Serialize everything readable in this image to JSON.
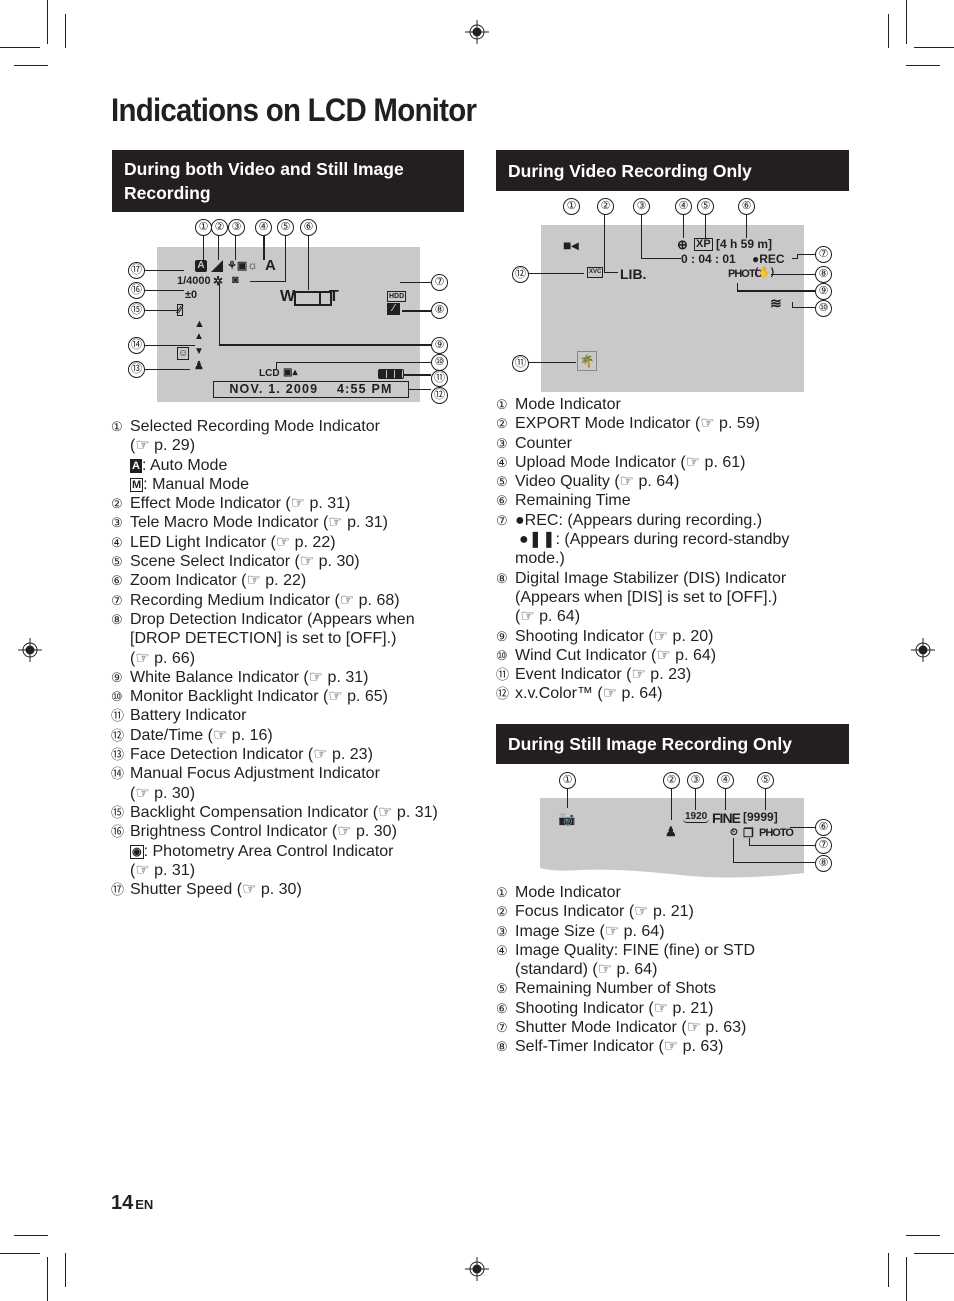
{
  "page": {
    "title": "Indications on LCD Monitor",
    "page_number": "14",
    "language": "EN",
    "ref_icon": "☞"
  },
  "sections": {
    "both": {
      "header": "During both Video and Still Image Recording",
      "lcd": {
        "shutter": "1/4000",
        "brightness": "±0",
        "zoom_w": "W",
        "zoom_t": "T",
        "medium": "HDD",
        "lcd_label": "LCD",
        "datetime": "NOV. 1. 2009    4:55 PM",
        "scene": "A"
      },
      "callouts": [
        "①",
        "②",
        "③",
        "④",
        "⑤",
        "⑥",
        "⑦",
        "⑧",
        "⑨",
        "⑩",
        "⑪",
        "⑫",
        "⑬",
        "⑭",
        "⑮",
        "⑯",
        "⑰"
      ],
      "items": [
        {
          "num": "①",
          "text": "Selected Recording Mode Indicator",
          "cont": "(☞ p. 29)"
        },
        {
          "num": "",
          "badge": "A",
          "badge_fill": true,
          "text": ": Auto Mode"
        },
        {
          "num": "",
          "badge": "M",
          "badge_fill": false,
          "text": ": Manual Mode"
        },
        {
          "num": "②",
          "text": "Effect Mode Indicator (☞ p. 31)"
        },
        {
          "num": "③",
          "text": "Tele Macro Mode Indicator (☞ p. 31)"
        },
        {
          "num": "④",
          "text": "LED Light Indicator (☞ p. 22)"
        },
        {
          "num": "⑤",
          "text": "Scene Select Indicator (☞ p. 30)"
        },
        {
          "num": "⑥",
          "text": "Zoom Indicator (☞ p. 22)"
        },
        {
          "num": "⑦",
          "text": "Recording Medium Indicator (☞ p. 68)"
        },
        {
          "num": "⑧",
          "text": "Drop Detection Indicator (Appears when",
          "cont": "[DROP DETECTION] is set to [OFF].)",
          "cont2": "(☞ p. 66)"
        },
        {
          "num": "⑨",
          "text": "White Balance Indicator (☞ p. 31)"
        },
        {
          "num": "⑩",
          "text": "Monitor Backlight Indicator (☞ p. 65)"
        },
        {
          "num": "⑪",
          "text": "Battery Indicator"
        },
        {
          "num": "⑫",
          "text": "Date/Time (☞ p. 16)"
        },
        {
          "num": "⑬",
          "text": "Face Detection Indicator (☞ p. 23)"
        },
        {
          "num": "⑭",
          "text": "Manual Focus Adjustment Indicator",
          "cont": "(☞ p. 30)"
        },
        {
          "num": "⑮",
          "text": "Backlight Compensation Indicator (☞ p. 31)"
        },
        {
          "num": "⑯",
          "text": "Brightness Control Indicator (☞ p. 30)"
        },
        {
          "num": "",
          "badge": "◉",
          "badge_fill": false,
          "text": ": Photometry Area Control Indicator",
          "cont": "(☞ p. 31)"
        },
        {
          "num": "⑰",
          "text": "Shutter Speed (☞ p. 30)"
        }
      ]
    },
    "video": {
      "header": "During Video Recording Only",
      "lcd": {
        "export": "LIB.",
        "xvc": "XVC",
        "quality": "XP",
        "remaining": "[4 h 59 m]",
        "counter": "0 : 04 : 01",
        "rec": "●REC",
        "photo": "PHOTO"
      },
      "callouts": [
        "①",
        "②",
        "③",
        "④",
        "⑤",
        "⑥",
        "⑦",
        "⑧",
        "⑨",
        "⑩",
        "⑪",
        "⑫"
      ],
      "items": [
        {
          "num": "①",
          "text": "Mode Indicator"
        },
        {
          "num": "②",
          "text": "EXPORT Mode Indicator (☞ p. 59)"
        },
        {
          "num": "③",
          "text": "Counter"
        },
        {
          "num": "④",
          "text": "Upload Mode Indicator (☞ p. 61)"
        },
        {
          "num": "⑤",
          "text": "Video Quality (☞ p. 64)"
        },
        {
          "num": "⑥",
          "text": "Remaining Time"
        },
        {
          "num": "⑦",
          "text": " ●REC: (Appears during recording.)",
          "cont": "●❚❚: (Appears during record-standby",
          "cont2": "mode.)"
        },
        {
          "num": "⑧",
          "text": "Digital Image Stabilizer (DIS) Indicator",
          "cont": "(Appears when [DIS] is set to [OFF].)",
          "cont2": "(☞ p. 64)"
        },
        {
          "num": "⑨",
          "text": "Shooting Indicator (☞ p. 20)"
        },
        {
          "num": "⑩",
          "text": "Wind Cut Indicator (☞ p. 64)"
        },
        {
          "num": "⑪",
          "text": "Event Indicator (☞ p. 23)"
        },
        {
          "num": "⑫",
          "text": "x.v.Color™ (☞ p. 64)"
        }
      ]
    },
    "still": {
      "header": "During Still Image Recording Only",
      "lcd": {
        "size": "1920",
        "quality": "FINE",
        "shots": "[9999]",
        "photo": "PHOTO"
      },
      "callouts": [
        "①",
        "②",
        "③",
        "④",
        "⑤",
        "⑥",
        "⑦",
        "⑧"
      ],
      "items": [
        {
          "num": "①",
          "text": "Mode Indicator"
        },
        {
          "num": "②",
          "text": "Focus Indicator (☞ p. 21)"
        },
        {
          "num": "③",
          "text": "Image Size (☞ p. 64)"
        },
        {
          "num": "④",
          "text": "Image Quality: FINE (fine) or STD",
          "cont": "(standard) (☞ p. 64)"
        },
        {
          "num": "⑤",
          "text": "Remaining Number of Shots"
        },
        {
          "num": "⑥",
          "text": "Shooting Indicator (☞ p. 21)"
        },
        {
          "num": "⑦",
          "text": "Shutter Mode Indicator (☞ p. 63)"
        },
        {
          "num": "⑧",
          "text": "Self-Timer Indicator (☞ p. 63)"
        }
      ]
    }
  }
}
